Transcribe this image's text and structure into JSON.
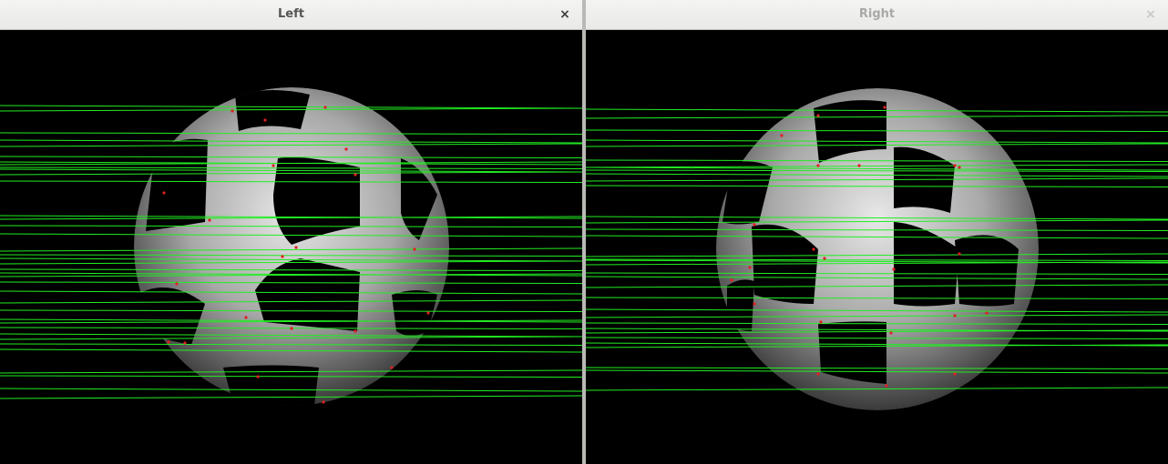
{
  "windows": {
    "left": {
      "title": "Left",
      "close_glyph": "×",
      "active": true
    },
    "right": {
      "title": "Right",
      "close_glyph": "×",
      "active": false
    }
  },
  "colors": {
    "titlebar_bg": "#f0f0ef",
    "canvas_bg": "#000000",
    "epipolar_line": "#22ee22",
    "keypoint": "#e02020",
    "sphere_light": "#e6e6e6",
    "sphere_dark": "#4a4a4a"
  },
  "icons": [
    "close-icon"
  ]
}
